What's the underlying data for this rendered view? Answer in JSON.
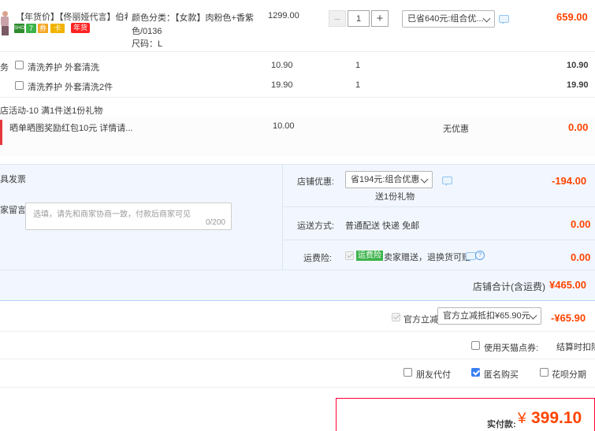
{
  "item": {
    "title": "【年货价】【佟丽娅代言】伯希...",
    "badges": [
      "SHOP",
      "7",
      "券",
      "卡"
    ],
    "promo_badge": "年货",
    "spec_color_label": "颜色分类：",
    "spec_color_value": "【女款】肉粉色+香紫",
    "spec_color_value2": "色/0136",
    "spec_size": "尺码：L",
    "price": "1299.00",
    "qty": "1",
    "minus": "−",
    "plus": "+",
    "discount_select": "已省640元:组合优...",
    "subtotal": "659.00"
  },
  "services": {
    "side_label": "务",
    "rows": [
      {
        "label": "清洗养护 外套清洗",
        "price": "10.90",
        "qty": "1",
        "total": "10.90"
      },
      {
        "label": "清洗养护 外套清洗2件",
        "price": "19.90",
        "qty": "1",
        "total": "19.90"
      }
    ]
  },
  "promo": {
    "activity": "店活动-10",
    "gift": "满1件送1份礼物",
    "gift_item": "晒单晒图奖励红包10元 详情请...",
    "gift_price": "10.00",
    "gift_discount": "无优惠",
    "gift_total": "0.00"
  },
  "summary": {
    "invoice_label": "具发票",
    "message_label": "家留言:",
    "message_placeholder": "选填，请先和商家协商一致，付款后商家可见",
    "message_count": "0/200",
    "shop_discount_label": "店铺优惠:",
    "shop_discount_select": "省194元:组合优惠",
    "shop_discount_note": "送1份礼物",
    "shop_discount_value": "-194.00",
    "shipping_label": "运送方式:",
    "shipping_value": "普通配送 快递 免邮",
    "shipping_cost": "0.00",
    "insurance_label": "运费险:",
    "insurance_tag": "运费险",
    "insurance_text": "卖家赠送，退换货可赔",
    "insurance_cost": "0.00",
    "shop_total_label": "店铺合计(含运费)",
    "shop_total_value": "¥465.00"
  },
  "official": {
    "label": "官方立减",
    "select": "官方立减抵扣¥65.90元",
    "value": "-¥65.90"
  },
  "points": {
    "label": "使用天猫点券:",
    "right_text": "结算时扣除"
  },
  "options": {
    "friend_pay": "朋友代付",
    "anonymous": "匿名购买",
    "huabei": "花呗分期"
  },
  "pay": {
    "label": "实付款:",
    "currency": "¥",
    "amount": "399.10"
  },
  "colors": {
    "accent": "#ff4400",
    "panel_bg": "#f2f7ff",
    "border_blue": "#b2d1ff"
  }
}
